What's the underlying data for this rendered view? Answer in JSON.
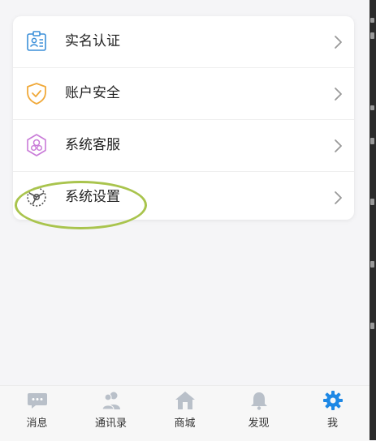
{
  "menu": {
    "items": [
      {
        "label": "实名认证",
        "icon": "id-badge-icon"
      },
      {
        "label": "账户安全",
        "icon": "shield-icon"
      },
      {
        "label": "系统客服",
        "icon": "customer-service-icon"
      },
      {
        "label": "系统设置",
        "icon": "settings-icon"
      }
    ]
  },
  "tabbar": {
    "tabs": [
      {
        "label": "消息",
        "icon": "chat-icon",
        "active": false
      },
      {
        "label": "通讯录",
        "icon": "contacts-icon",
        "active": false
      },
      {
        "label": "商城",
        "icon": "home-icon",
        "active": false
      },
      {
        "label": "发现",
        "icon": "bell-icon",
        "active": false
      },
      {
        "label": "我",
        "icon": "gear-icon",
        "active": true
      }
    ]
  },
  "colors": {
    "accent_active": "#1e88e5",
    "tab_inactive_icon": "#b9c0c9",
    "id_icon": "#3b8fd9",
    "shield_icon": "#f0a93a",
    "service_icon": "#c97bd8",
    "settings_icon": "#555555",
    "highlight_ring": "#a9c44d"
  }
}
